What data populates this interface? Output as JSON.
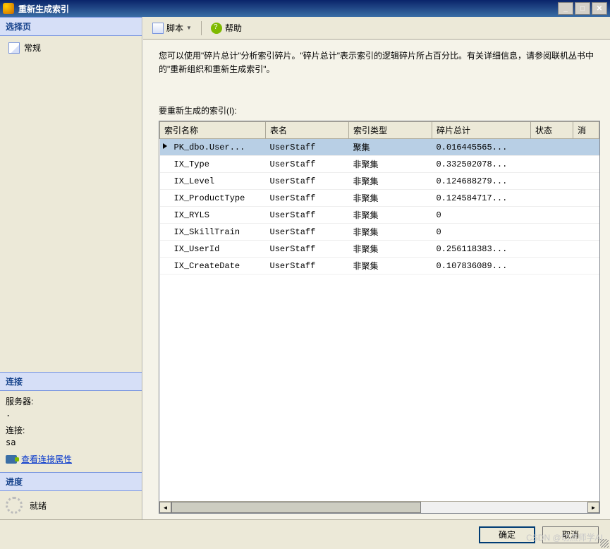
{
  "window": {
    "title": "重新生成索引"
  },
  "left": {
    "select_page": "选择页",
    "general": "常规",
    "connection_header": "连接",
    "server_label": "服务器:",
    "server_value": ".",
    "conn_label": "连接:",
    "conn_value": "sa",
    "view_props": "查看连接属性",
    "progress_header": "进度",
    "ready": "就绪"
  },
  "toolbar": {
    "script": "脚本",
    "help": "帮助"
  },
  "content": {
    "description": "您可以使用\"碎片总计\"分析索引碎片。\"碎片总计\"表示索引的逻辑碎片所占百分比。有关详细信息，请参阅联机丛书中的\"重新组织和重新生成索引\"。",
    "grid_label": "要重新生成的索引(I):"
  },
  "columns": {
    "index_name": "索引名称",
    "table_name": "表名",
    "index_type": "索引类型",
    "frag_total": "碎片总计",
    "status": "状态",
    "msg": "消"
  },
  "rows": [
    {
      "idx": "PK_dbo.User...",
      "tbl": "UserStaff",
      "type": "聚集",
      "frag": "0.016445565...",
      "stat": ""
    },
    {
      "idx": "IX_Type",
      "tbl": "UserStaff",
      "type": "非聚集",
      "frag": "0.332502078...",
      "stat": ""
    },
    {
      "idx": "IX_Level",
      "tbl": "UserStaff",
      "type": "非聚集",
      "frag": "0.124688279...",
      "stat": ""
    },
    {
      "idx": "IX_ProductType",
      "tbl": "UserStaff",
      "type": "非聚集",
      "frag": "0.124584717...",
      "stat": ""
    },
    {
      "idx": "IX_RYLS",
      "tbl": "UserStaff",
      "type": "非聚集",
      "frag": "0",
      "stat": ""
    },
    {
      "idx": "IX_SkillTrain",
      "tbl": "UserStaff",
      "type": "非聚集",
      "frag": "0",
      "stat": ""
    },
    {
      "idx": "IX_UserId",
      "tbl": "UserStaff",
      "type": "非聚集",
      "frag": "0.256118383...",
      "stat": ""
    },
    {
      "idx": "IX_CreateDate",
      "tbl": "UserStaff",
      "type": "非聚集",
      "frag": "0.107836089...",
      "stat": ""
    }
  ],
  "buttons": {
    "ok": "确定",
    "cancel": "取消"
  },
  "watermark": "CSDN @切点师学AI"
}
